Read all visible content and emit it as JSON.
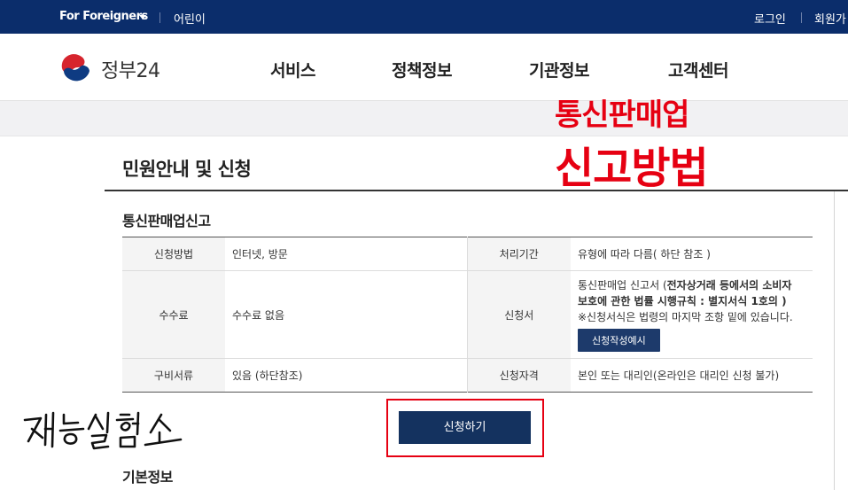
{
  "topbar": {
    "foreigners_label": "For Foreigners",
    "kids_label": "어린이",
    "login_label": "로그인",
    "join_label": "회원가"
  },
  "header": {
    "logo_text": "정부24",
    "nav": [
      "서비스",
      "정책정보",
      "기관정보",
      "고객센터"
    ]
  },
  "overlay": {
    "line1": "통신판매업",
    "line2": "신고방법",
    "handwriting": "재능실험소",
    "color": "#e60012"
  },
  "main": {
    "page_title": "민원안내 및 신청",
    "section_title": "통신판매업신고",
    "table": {
      "method_label": "신청방법",
      "method_value": "인터넷, 방문",
      "period_label": "처리기간",
      "period_value": "유형에 따라 다름( 하단 참조 )",
      "fee_label": "수수료",
      "fee_value": "수수료 없음",
      "form_label": "신청서",
      "form_value_plain": "통신판매업 신고서 (",
      "form_value_bold1": "전자상거래 등에서의 소비자",
      "form_value_bold2": "보호에 관한 법률 시행규칙 : 별지서식 1호의 )",
      "form_note": "※신청서식은 법령의 마지막 조항 밑에 있습니다.",
      "form_example_button": "신청작성예시",
      "docs_label": "구비서류",
      "docs_value": "있음 (하단참조)",
      "eligibility_label": "신청자격",
      "eligibility_value": "본인 또는 대리인(온라인은 대리인 신청 불가)"
    },
    "apply_button": "신청하기",
    "basic_info_title": "기본정보"
  },
  "colors": {
    "topbar_bg": "#0b2d6b",
    "button_bg": "#14325f",
    "highlight": "#e60012"
  }
}
